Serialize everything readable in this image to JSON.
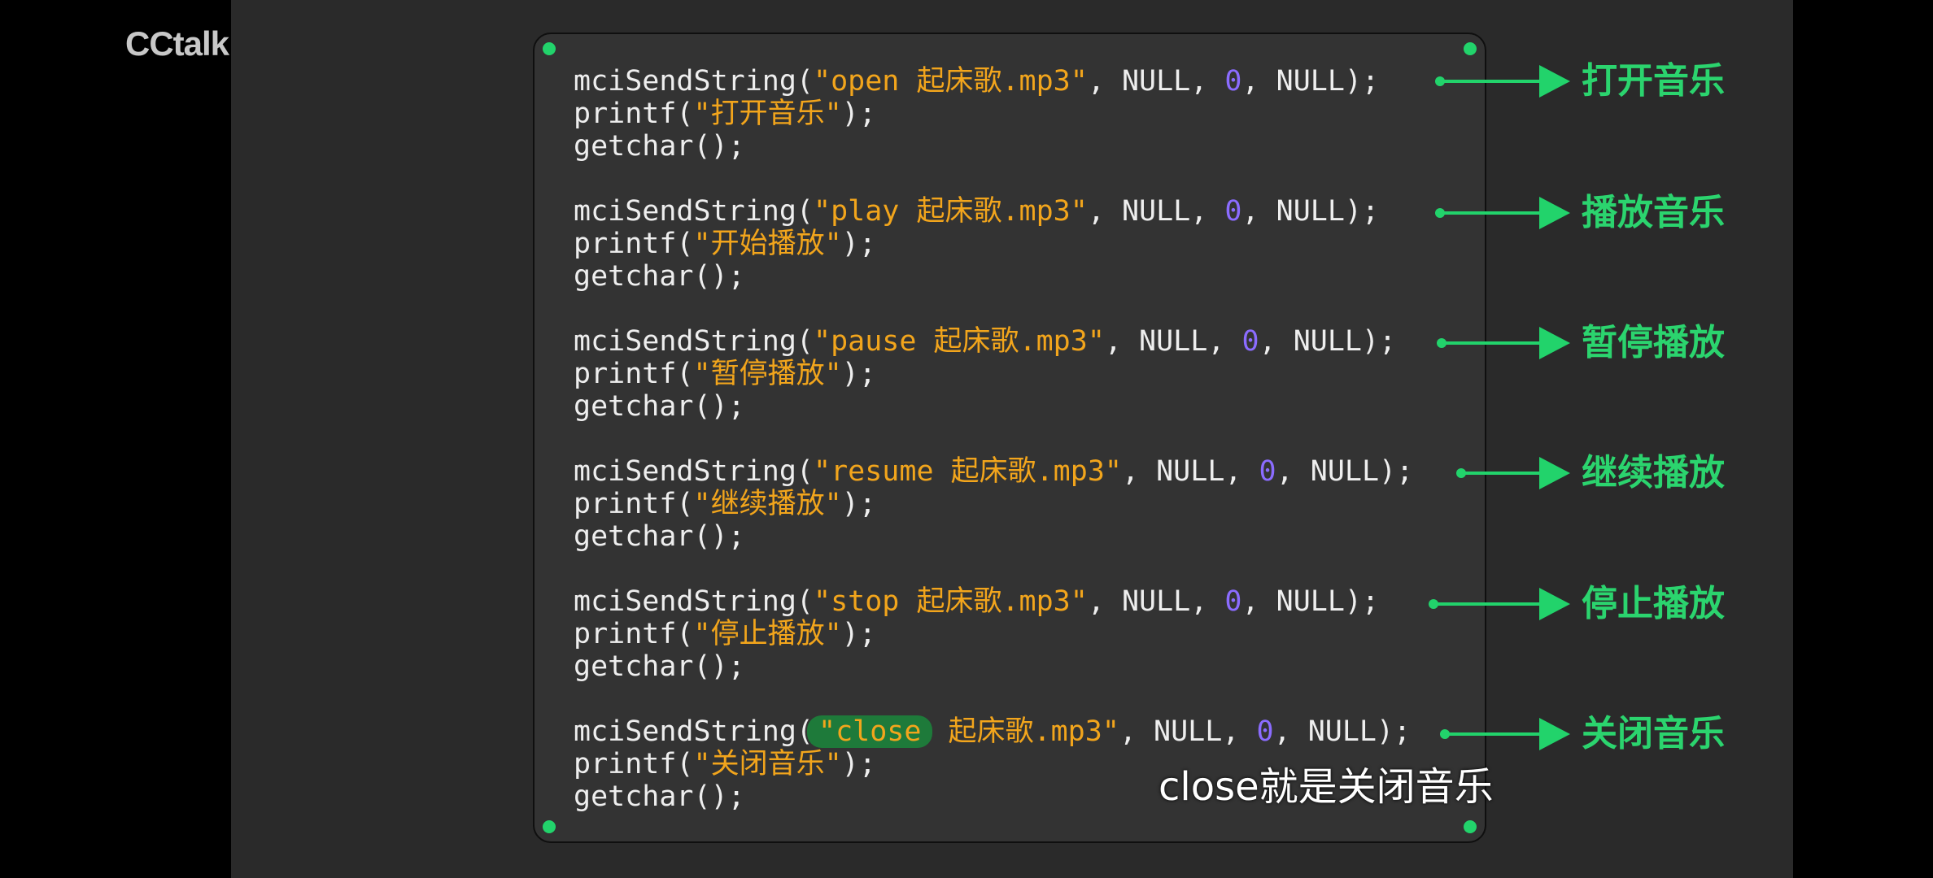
{
  "app": {
    "logo": "CCtalk"
  },
  "code_blocks": [
    {
      "fn": "mciSendString(",
      "open_quote": "\"",
      "command": "open",
      "file": " 起床歌.mp3",
      "close_quote": "\"",
      "args_a": ", NULL, ",
      "zero": "0",
      "args_b": ", NULL);",
      "printf_prefix": "printf(",
      "printf_text": "\"打开音乐\"",
      "printf_suffix": ");",
      "getchar": "getchar();",
      "label": "打开音乐",
      "highlight": false
    },
    {
      "fn": "mciSendString(",
      "open_quote": "\"",
      "command": "play",
      "file": " 起床歌.mp3",
      "close_quote": "\"",
      "args_a": ", NULL, ",
      "zero": "0",
      "args_b": ", NULL);",
      "printf_prefix": "printf(",
      "printf_text": "\"开始播放\"",
      "printf_suffix": ");",
      "getchar": "getchar();",
      "label": "播放音乐",
      "highlight": false
    },
    {
      "fn": "mciSendString(",
      "open_quote": "\"",
      "command": "pause",
      "file": " 起床歌.mp3",
      "close_quote": "\"",
      "args_a": ", NULL, ",
      "zero": "0",
      "args_b": ", NULL);",
      "printf_prefix": "printf(",
      "printf_text": "\"暂停播放\"",
      "printf_suffix": ");",
      "getchar": "getchar();",
      "label": "暂停播放",
      "highlight": false
    },
    {
      "fn": "mciSendString(",
      "open_quote": "\"",
      "command": "resume",
      "file": " 起床歌.mp3",
      "close_quote": "\"",
      "args_a": ", NULL, ",
      "zero": "0",
      "args_b": ", NULL);",
      "printf_prefix": "printf(",
      "printf_text": "\"继续播放\"",
      "printf_suffix": ");",
      "getchar": "getchar();",
      "label": "继续播放",
      "highlight": false
    },
    {
      "fn": "mciSendString(",
      "open_quote": "\"",
      "command": "stop",
      "file": " 起床歌.mp3",
      "close_quote": "\"",
      "args_a": ", NULL, ",
      "zero": "0",
      "args_b": ", NULL);",
      "printf_prefix": "printf(",
      "printf_text": "\"停止播放\"",
      "printf_suffix": ");",
      "getchar": "getchar();",
      "label": "停止播放",
      "highlight": false
    },
    {
      "fn": "mciSendString(",
      "open_quote": "\"",
      "command": "close",
      "file": " 起床歌.mp3",
      "close_quote": "\"",
      "args_a": ", NULL, ",
      "zero": "0",
      "args_b": ", NULL);",
      "printf_prefix": "printf(",
      "printf_text": "\"关闭音乐\"",
      "printf_suffix": ");",
      "getchar": "getchar();",
      "label": "关闭音乐",
      "highlight": true
    }
  ],
  "subtitle": "close就是关闭音乐",
  "colors": {
    "accent_green": "#22d36b",
    "string_orange": "#f2a51c",
    "number_purple": "#8b6cff",
    "code_bg": "#333333"
  }
}
